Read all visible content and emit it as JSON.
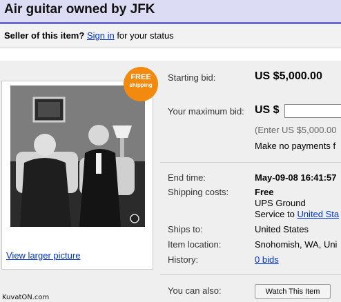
{
  "title": "Air guitar owned by JFK",
  "seller": {
    "prefix": "Seller of this item?",
    "link": "Sign in",
    "suffix": "for your status"
  },
  "badge": {
    "line1": "FREE",
    "line2": "shipping"
  },
  "picture": {
    "view_larger": "View larger picture"
  },
  "bid": {
    "starting_label": "Starting bid:",
    "starting_value": "US $5,000.00",
    "max_label": "Your maximum bid:",
    "currency_prefix": "US $",
    "input_value": "",
    "hint": "(Enter US $5,000.00",
    "payments_note": "Make no payments f"
  },
  "details": {
    "end_time_label": "End time:",
    "end_time_value": "May-09-08 16:41:57",
    "shipping_label": "Shipping costs:",
    "shipping_value": "Free",
    "shipping_method": "UPS Ground",
    "service_prefix": "Service to",
    "service_link": "United Sta",
    "ships_to_label": "Ships to:",
    "ships_to_value": "United States",
    "location_label": "Item location:",
    "location_value": "Snohomish, WA, Uni",
    "history_label": "History:",
    "history_value": "0 bids"
  },
  "actions": {
    "you_can_also": "You can also:",
    "watch_button": "Watch This Item"
  },
  "watermark": "KuvatON.com",
  "colors": {
    "title_bar": "#dcdcf4",
    "accent": "#6a6ad0",
    "badge": "#f28a10",
    "link": "#0033cc"
  }
}
